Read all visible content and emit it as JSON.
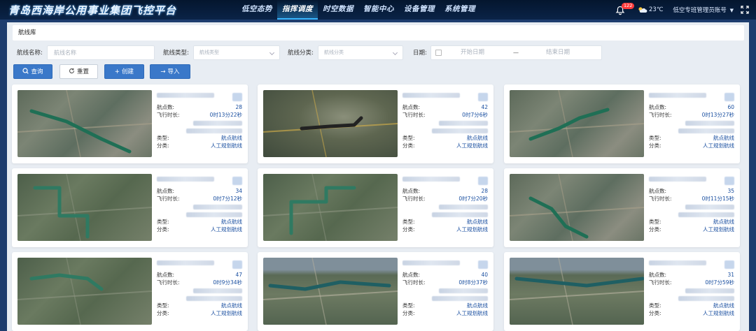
{
  "app": {
    "title": "青岛西海岸公用事业集团飞控平台"
  },
  "nav": {
    "items": [
      {
        "label": "低空态势",
        "active": false
      },
      {
        "label": "指挥调度",
        "active": true
      },
      {
        "label": "时空数据",
        "active": false
      },
      {
        "label": "智能中心",
        "active": false
      },
      {
        "label": "设备管理",
        "active": false
      },
      {
        "label": "系统管理",
        "active": false
      }
    ]
  },
  "topbar": {
    "notification_count": "122",
    "temperature": "23℃",
    "account": "低空专班管理员账号",
    "icons": [
      "bell-icon",
      "cloud-icon",
      "fullscreen-icon"
    ]
  },
  "page": {
    "breadcrumb": "航线库"
  },
  "filters": {
    "name_label": "航线名称:",
    "name_placeholder": "航线名称",
    "type_label": "航线类型:",
    "type_placeholder": "航线类型",
    "category_label": "航线分类:",
    "category_placeholder": "航线分类",
    "date_label": "日期:",
    "start_placeholder": "开始日期",
    "date_sep": "—",
    "end_placeholder": "结束日期"
  },
  "buttons": {
    "query": "查询",
    "reset": "重置",
    "create": "创建",
    "import": "导入"
  },
  "card_labels": {
    "waypoints": "航点数:",
    "duration": "飞行时长:",
    "type": "类型:",
    "category": "分类:"
  },
  "routes": [
    {
      "waypoints": "28",
      "duration": "0时13分22秒",
      "type": "航点航线",
      "category": "人工规划航线",
      "theme": "urban"
    },
    {
      "waypoints": "42",
      "duration": "0时7分6秒",
      "type": "航点航线",
      "category": "人工规划航线",
      "theme": "zoom"
    },
    {
      "waypoints": "60",
      "duration": "0时13分27秒",
      "type": "航点航线",
      "category": "人工规划航线",
      "theme": "urban"
    },
    {
      "waypoints": "34",
      "duration": "0时7分12秒",
      "type": "航点航线",
      "category": "人工规划航线",
      "theme": "green"
    },
    {
      "waypoints": "28",
      "duration": "0时7分20秒",
      "type": "航点航线",
      "category": "人工规划航线",
      "theme": "green"
    },
    {
      "waypoints": "35",
      "duration": "0时11分15秒",
      "type": "航点航线",
      "category": "人工规划航线",
      "theme": "urban"
    },
    {
      "waypoints": "47",
      "duration": "0时9分34秒",
      "type": "航点航线",
      "category": "人工规划航线",
      "theme": "green"
    },
    {
      "waypoints": "40",
      "duration": "0时8分37秒",
      "type": "航点航线",
      "category": "人工规划航线",
      "theme": "coast"
    },
    {
      "waypoints": "31",
      "duration": "0时7分59秒",
      "type": "航点航线",
      "category": "人工规划航线",
      "theme": "coast"
    }
  ]
}
